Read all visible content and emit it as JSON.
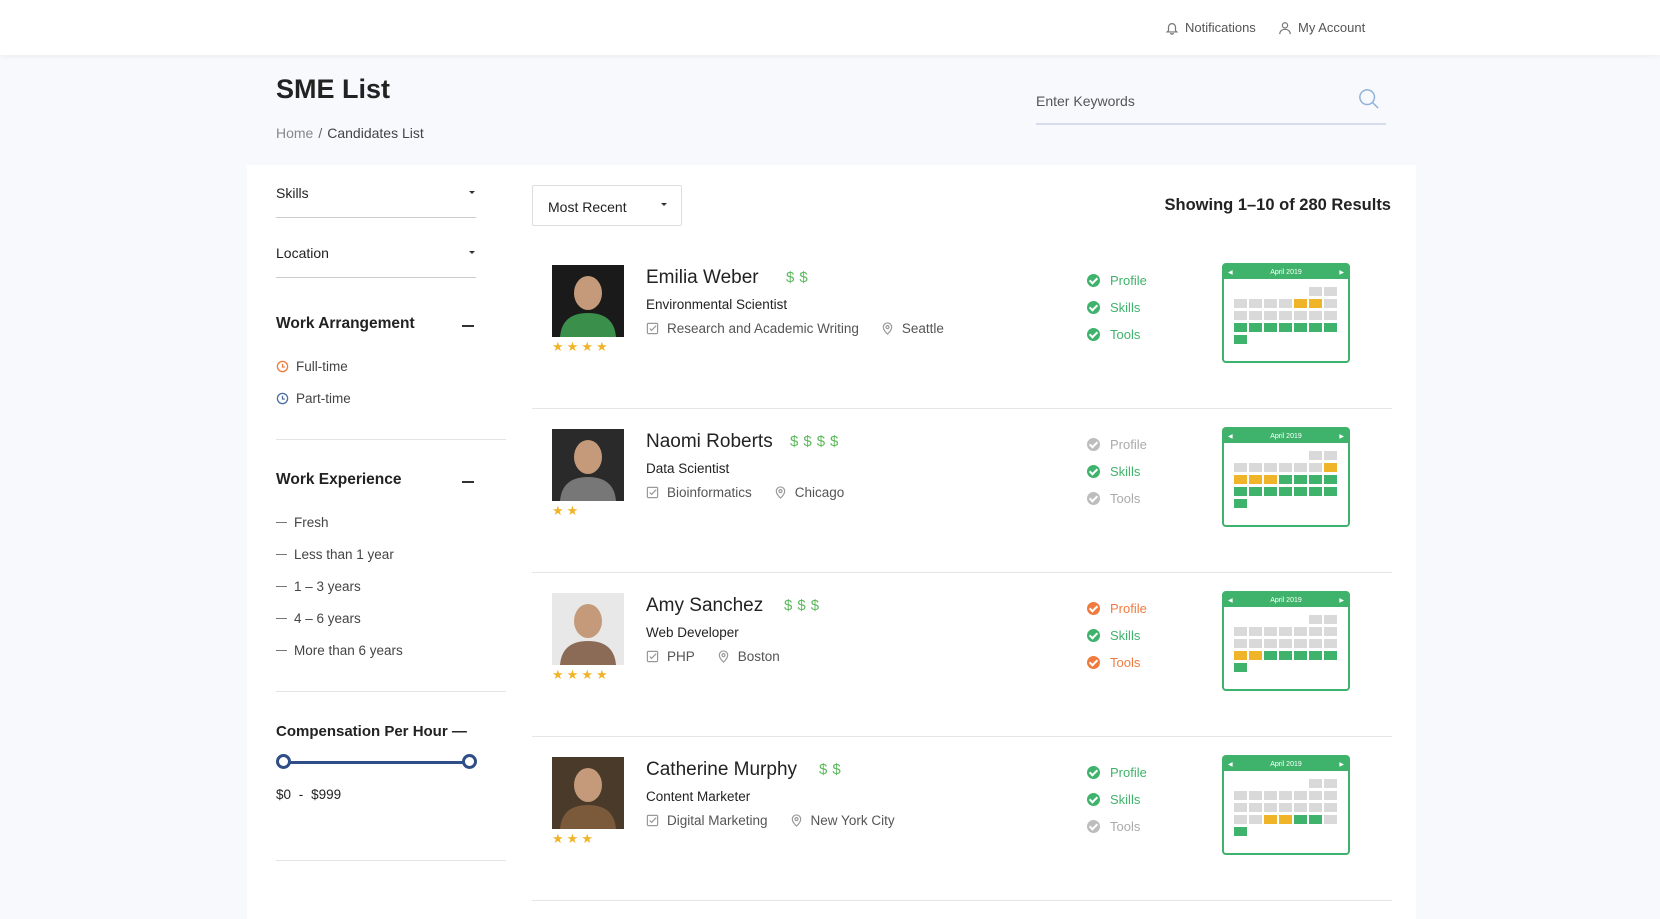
{
  "topbar": {
    "notifications_label": "Notifications",
    "account_label": "My Account"
  },
  "page": {
    "title": "SME List",
    "breadcrumb_home": "Home",
    "breadcrumb_separator": "/",
    "breadcrumb_current": "Candidates List"
  },
  "search": {
    "placeholder": "Enter Keywords"
  },
  "filters": {
    "skills_label": "Skills",
    "location_label": "Location",
    "work_arrangement": {
      "title": "Work Arrangement",
      "options": [
        {
          "label": "Full-time",
          "color": "#f07b3f"
        },
        {
          "label": "Part-time",
          "color": "#4a6fa5"
        }
      ]
    },
    "work_experience": {
      "title": "Work Experience",
      "options": [
        "Fresh",
        "Less than 1 year",
        "1 – 3 years",
        "4 – 6 years",
        "More than 6 years"
      ]
    },
    "compensation": {
      "title": "Compensation Per Hour",
      "min": "$0",
      "separator": "-",
      "max": "$999"
    }
  },
  "listing": {
    "sort_label": "Most Recent",
    "results_text": "Showing 1–10 of 280 Results",
    "calendar_title": "April 2019",
    "colors": {
      "green": "#3fb36b",
      "orange": "#f07b3f",
      "gray": "#bdbdbd",
      "amber": "#f0b429",
      "cell_gray": "#d9d9d9"
    },
    "candidates": [
      {
        "name": "Emilia Weber",
        "dollars": 2,
        "stars": 4,
        "role": "Environmental Scientist",
        "skill": "Research and Academic Writing",
        "location": "Seattle",
        "checks": [
          {
            "label": "Profile",
            "status": "green"
          },
          {
            "label": "Skills",
            "status": "green"
          },
          {
            "label": "Tools",
            "status": "green"
          }
        ],
        "calendar": [
          "e",
          "e",
          "e",
          "e",
          "e",
          "g",
          "g",
          "g",
          "g",
          "g",
          "g",
          "a",
          "a",
          "g",
          "g",
          "g",
          "g",
          "g",
          "g",
          "g",
          "g",
          "G",
          "G",
          "G",
          "G",
          "G",
          "G",
          "G",
          "G"
        ]
      },
      {
        "name": "Naomi Roberts",
        "dollars": 4,
        "stars": 2,
        "role": "Data Scientist",
        "skill": "Bioinformatics",
        "location": "Chicago",
        "checks": [
          {
            "label": "Profile",
            "status": "gray"
          },
          {
            "label": "Skills",
            "status": "green"
          },
          {
            "label": "Tools",
            "status": "gray"
          }
        ],
        "calendar": [
          "e",
          "e",
          "e",
          "e",
          "e",
          "g",
          "g",
          "g",
          "g",
          "g",
          "g",
          "g",
          "g",
          "a",
          "A",
          "A",
          "A",
          "G",
          "G",
          "G",
          "G",
          "G",
          "G",
          "G",
          "G",
          "G",
          "G",
          "G",
          "G"
        ]
      },
      {
        "name": "Amy Sanchez",
        "dollars": 3,
        "stars": 4,
        "role": "Web Developer",
        "skill": "PHP",
        "location": "Boston",
        "checks": [
          {
            "label": "Profile",
            "status": "orange"
          },
          {
            "label": "Skills",
            "status": "green"
          },
          {
            "label": "Tools",
            "status": "orange"
          }
        ],
        "calendar": [
          "e",
          "e",
          "e",
          "e",
          "e",
          "g",
          "g",
          "g",
          "g",
          "g",
          "g",
          "g",
          "g",
          "g",
          "g",
          "g",
          "g",
          "g",
          "g",
          "g",
          "g",
          "A",
          "A",
          "G",
          "G",
          "G",
          "G",
          "G",
          "G"
        ]
      },
      {
        "name": "Catherine Murphy",
        "dollars": 2,
        "stars": 3,
        "role": "Content Marketer",
        "skill": "Digital Marketing",
        "location": "New York City",
        "checks": [
          {
            "label": "Profile",
            "status": "green"
          },
          {
            "label": "Skills",
            "status": "green"
          },
          {
            "label": "Tools",
            "status": "gray"
          }
        ],
        "calendar": [
          "e",
          "e",
          "e",
          "e",
          "e",
          "g",
          "g",
          "g",
          "g",
          "g",
          "g",
          "g",
          "g",
          "g",
          "g",
          "g",
          "g",
          "g",
          "g",
          "g",
          "g",
          "g",
          "g",
          "A",
          "A",
          "G",
          "G",
          "g",
          "G"
        ]
      }
    ]
  }
}
